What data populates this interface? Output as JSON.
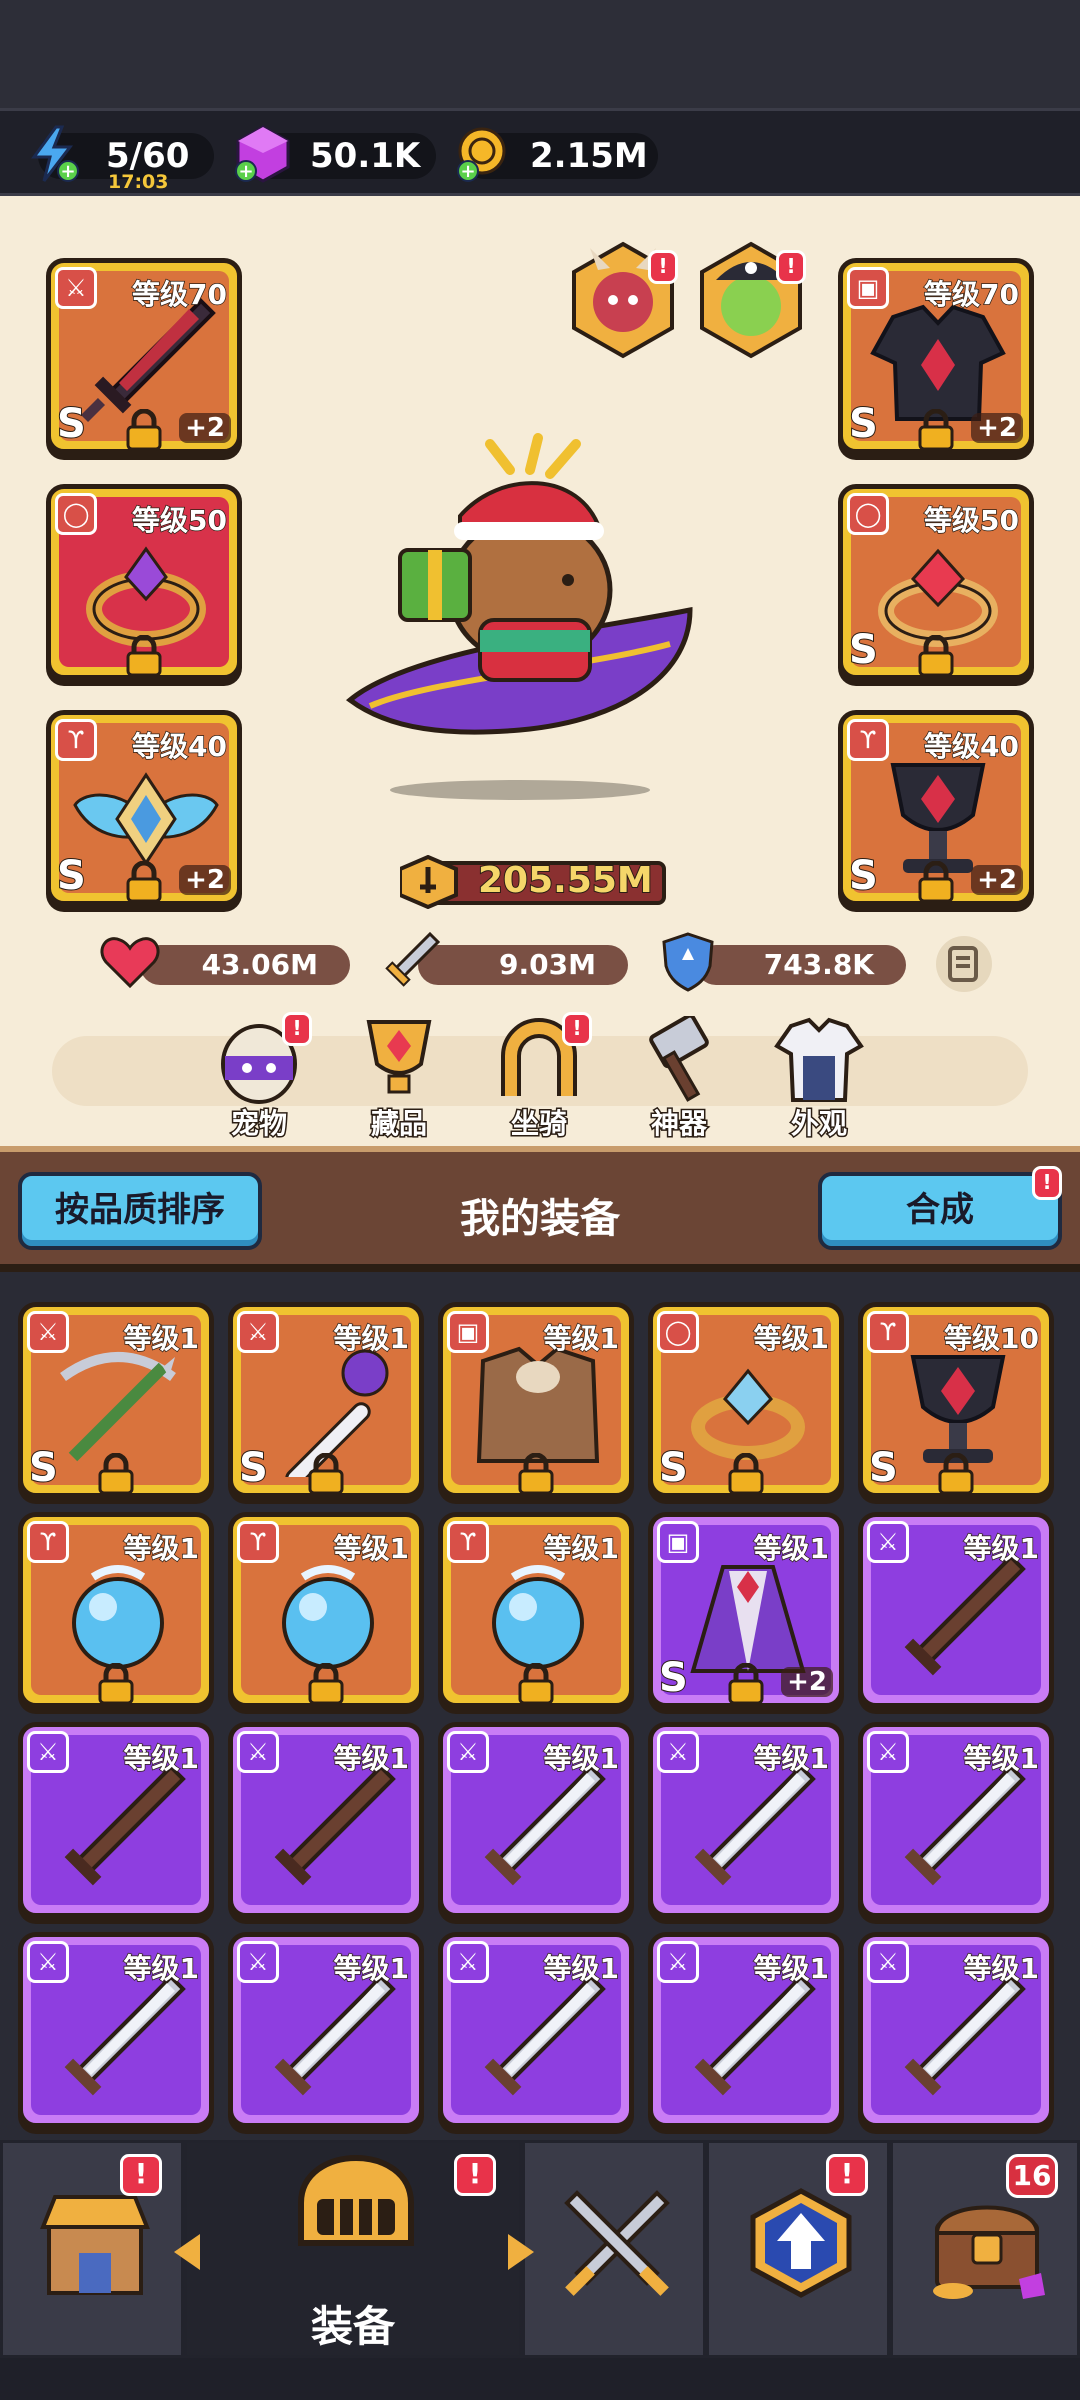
{
  "resources": {
    "energy": "5/60",
    "energy_timer": "17:03",
    "gems": "50.1K",
    "gold": "2.15M"
  },
  "character": {
    "left_slots": [
      {
        "icon": "sword-icon",
        "level": "等级70",
        "grade": "S",
        "plus": "+2",
        "frame": "orange"
      },
      {
        "icon": "ring-icon",
        "level": "等级50",
        "grade": "",
        "plus": "",
        "frame": "red"
      },
      {
        "icon": "necklace-icon",
        "level": "等级40",
        "grade": "S",
        "plus": "+2",
        "frame": "orange"
      }
    ],
    "right_slots": [
      {
        "icon": "armor-icon",
        "level": "等级70",
        "grade": "S",
        "plus": "+2",
        "frame": "orange"
      },
      {
        "icon": "ring-icon",
        "level": "等级50",
        "grade": "S",
        "plus": "",
        "frame": "orange"
      },
      {
        "icon": "necklace-icon",
        "level": "等级40",
        "grade": "S",
        "plus": "+2",
        "frame": "orange"
      }
    ],
    "power": "205.55M",
    "hp": "43.06M",
    "attack": "9.03M",
    "defense": "743.8K",
    "alert": "!"
  },
  "features": [
    {
      "label": "宠物",
      "icon": "pet-egg-icon",
      "alert": "!"
    },
    {
      "label": "藏品",
      "icon": "trophy-icon",
      "alert": ""
    },
    {
      "label": "坐骑",
      "icon": "horseshoe-icon",
      "alert": "!"
    },
    {
      "label": "神器",
      "icon": "hammer-icon",
      "alert": ""
    },
    {
      "label": "外观",
      "icon": "outfit-icon",
      "alert": ""
    }
  ],
  "equipment_header": {
    "sort_label": "按品质排序",
    "title": "我的装备",
    "merge_label": "合成",
    "merge_alert": "!"
  },
  "inventory": [
    {
      "icon": "crossbow-icon",
      "level": "等级1",
      "grade": "S",
      "plus": "",
      "frame": "orange"
    },
    {
      "icon": "staff-icon",
      "level": "等级1",
      "grade": "S",
      "plus": "",
      "frame": "orange"
    },
    {
      "icon": "fur-armor-icon",
      "level": "等级1",
      "grade": "",
      "plus": "",
      "frame": "orange"
    },
    {
      "icon": "ring-icon",
      "level": "等级1",
      "grade": "S",
      "plus": "",
      "frame": "orange"
    },
    {
      "icon": "chalice-icon",
      "level": "等级10",
      "grade": "S",
      "plus": "",
      "frame": "orange"
    },
    {
      "icon": "orb-icon",
      "level": "等级1",
      "grade": "",
      "plus": "",
      "frame": "orange"
    },
    {
      "icon": "orb-icon",
      "level": "等级1",
      "grade": "",
      "plus": "",
      "frame": "orange"
    },
    {
      "icon": "orb-icon",
      "level": "等级1",
      "grade": "",
      "plus": "",
      "frame": "orange"
    },
    {
      "icon": "cloak-icon",
      "level": "等级1",
      "grade": "S",
      "plus": "+2",
      "frame": "purple"
    },
    {
      "icon": "wood-sword-icon",
      "level": "等级1",
      "grade": "",
      "plus": "",
      "frame": "purple"
    },
    {
      "icon": "wood-sword-icon",
      "level": "等级1",
      "grade": "",
      "plus": "",
      "frame": "purple"
    },
    {
      "icon": "wood-sword-icon",
      "level": "等级1",
      "grade": "",
      "plus": "",
      "frame": "purple"
    },
    {
      "icon": "steel-sword-icon",
      "level": "等级1",
      "grade": "",
      "plus": "",
      "frame": "purple"
    },
    {
      "icon": "steel-sword-icon",
      "level": "等级1",
      "grade": "",
      "plus": "",
      "frame": "purple"
    },
    {
      "icon": "steel-sword-icon",
      "level": "等级1",
      "grade": "",
      "plus": "",
      "frame": "purple"
    },
    {
      "icon": "steel-sword-icon",
      "level": "等级1",
      "grade": "",
      "plus": "",
      "frame": "purple"
    },
    {
      "icon": "steel-sword-icon",
      "level": "等级1",
      "grade": "",
      "plus": "",
      "frame": "purple"
    },
    {
      "icon": "steel-sword-icon",
      "level": "等级1",
      "grade": "",
      "plus": "",
      "frame": "purple"
    },
    {
      "icon": "steel-sword-icon",
      "level": "等级1",
      "grade": "",
      "plus": "",
      "frame": "purple"
    },
    {
      "icon": "steel-sword-icon",
      "level": "等级1",
      "grade": "",
      "plus": "",
      "frame": "purple"
    }
  ],
  "nav": {
    "tabs": [
      {
        "icon": "shop-icon",
        "label": "",
        "alert": "!",
        "badge": ""
      },
      {
        "icon": "helmet-icon",
        "label": "装备",
        "alert": "!",
        "badge": ""
      },
      {
        "icon": "crossed-swords-icon",
        "label": "",
        "alert": "",
        "badge": ""
      },
      {
        "icon": "upgrade-arrow-icon",
        "label": "",
        "alert": "!",
        "badge": ""
      },
      {
        "icon": "treasure-chest-icon",
        "label": "",
        "alert": "",
        "badge": "16"
      }
    ]
  },
  "colors": {
    "orange_frame": "#f0c330",
    "orange_inner": "#d9733d",
    "purple_inner": "#8e3ee0",
    "alert_red": "#e8334a",
    "button_blue": "#5cc8f0"
  }
}
